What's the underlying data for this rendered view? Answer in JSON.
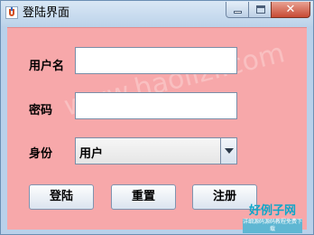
{
  "window": {
    "title": "登陆界面"
  },
  "form": {
    "username_label": "用户名",
    "username_value": "",
    "password_label": "密码",
    "password_value": "",
    "role_label": "身份",
    "role_selected": "用户"
  },
  "buttons": {
    "login": "登陆",
    "reset": "重置",
    "register": "注册"
  },
  "watermark": "www.haolizi.com",
  "logo": {
    "main": "好例子网",
    "sub": "详细源码源码教程免费下载"
  },
  "colors": {
    "content_bg": "#f7a8aa",
    "titlebar": "#bcd3ea",
    "close_button": "#c84a34"
  },
  "icons": {
    "app": "java-icon",
    "minimize": "minimize-icon",
    "maximize": "maximize-icon",
    "close": "close-icon",
    "dropdown": "chevron-down-icon"
  }
}
